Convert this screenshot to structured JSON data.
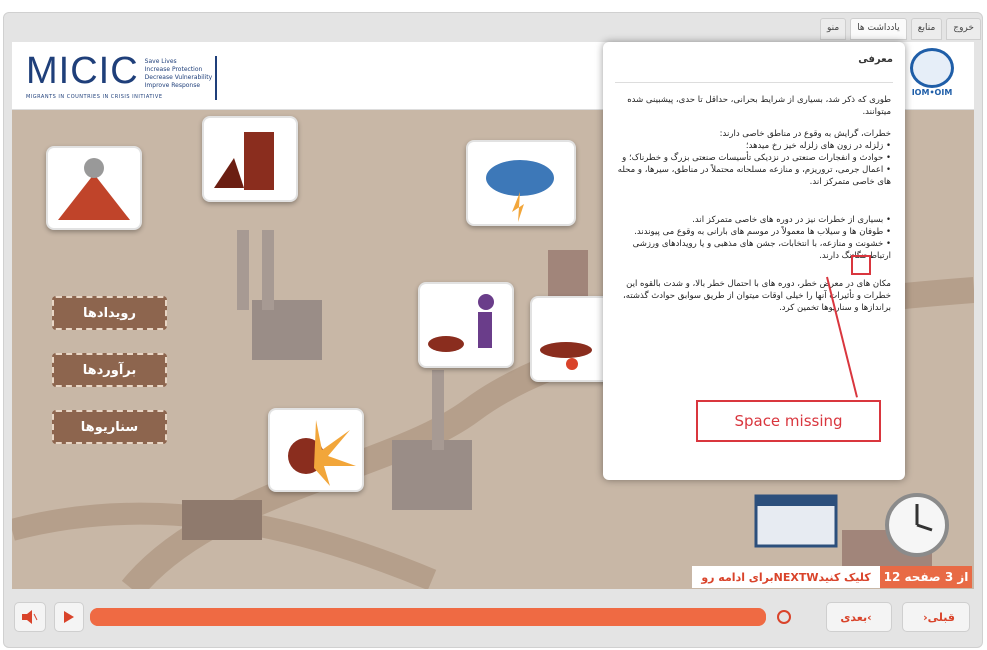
{
  "top_tabs": [
    {
      "label": "خروج",
      "active": false
    },
    {
      "label": "منابع",
      "active": false
    },
    {
      "label": "یادداشت ها",
      "active": true
    },
    {
      "label": "منو",
      "active": false
    }
  ],
  "header": {
    "logo_text": "MICIC",
    "logo_taglines": [
      "Save Lives",
      "Increase Protection",
      "Decrease Vulnerability",
      "Improve Response"
    ],
    "logo_subtitle": "MIGRANTS IN COUNTRIES IN CRISIS INITIATIVE",
    "org_label": "IOM•OIM"
  },
  "menu_buttons": [
    {
      "label": "رویدادها"
    },
    {
      "label": "برآوردها"
    },
    {
      "label": "سناریوها"
    }
  ],
  "popup": {
    "title": "معرفی",
    "intro": "طوری که ذکر شد، بسیاری از شرایط بحرانی، حداقل تا حدی، پیشبینی شده میتوانند.",
    "list1_heading": "خطرات، گرایش به وقوع در مناطق خاصی دارند:",
    "list1": [
      "زلزله در زون های زلزله خیز رخ میدهد؛",
      "حوادث و انفجارات صنعتی در نزدیکی تأسیسات صنعتی بزرگ و خطرناک؛ و",
      "اعمال جرمی، تروریزم، و منازعه مسلحانه محتملاً در مناطق، سیرها، و محله های خاصی متمرکز اند."
    ],
    "list2": [
      "بسیاری از خطرات نیز در دوره های خاصی متمرکز اند.",
      "طوفان ها و سیلاب ها معمولاً در موسم های بارانی به وقوع می پیوندند.",
      "خشونت و منازعه، با انتخابات، جشن های مذهبی و یا رویدادهای ورزشی ارتباط تنگاتنگ دارند."
    ],
    "closing": "مکان های در معرض خطر، دوره های با احتمال خطر بالا، و شدت بالقوه این خطرات و تأثیرات آنها را خیلی اوقات میتوان از طریق سوابق حوادث گذشته، براندازها و سناریوها تخمین کرد."
  },
  "annotation": {
    "label": "Space missing"
  },
  "status": {
    "message": "برای ادامه روNEXTWکلیک کنید",
    "page": "12 از 3 صفحه"
  },
  "controls": {
    "prev_label": "قبلی",
    "next_label": "بعدی",
    "progress": 1.0
  },
  "colors": {
    "accent": "#ef6a43",
    "annotation": "#d9363e",
    "menu_button": "#8d654e",
    "scene_bg": "#c8b7a6"
  }
}
